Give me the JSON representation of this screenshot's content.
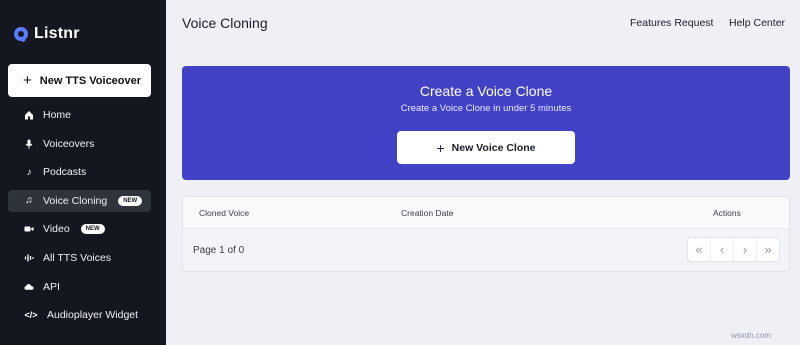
{
  "app": {
    "brand": "Listnr"
  },
  "sidebar": {
    "new_button": "New TTS Voiceover",
    "items": [
      {
        "label": "Home",
        "icon": "home-icon",
        "active": false,
        "badge": ""
      },
      {
        "label": "Voiceovers",
        "icon": "microphone-icon",
        "active": false,
        "badge": ""
      },
      {
        "label": "Podcasts",
        "icon": "music-note-icon",
        "active": false,
        "badge": ""
      },
      {
        "label": "Voice Cloning",
        "icon": "music-notes-icon",
        "active": true,
        "badge": "NEW"
      },
      {
        "label": "Video",
        "icon": "video-camera-icon",
        "active": false,
        "badge": "NEW"
      },
      {
        "label": "All TTS Voices",
        "icon": "waveform-icon",
        "active": false,
        "badge": ""
      },
      {
        "label": "API",
        "icon": "cloud-icon",
        "active": false,
        "badge": ""
      },
      {
        "label": "Audioplayer Widget",
        "icon": "code-icon",
        "active": false,
        "badge": ""
      }
    ]
  },
  "header": {
    "title": "Voice Cloning",
    "links": [
      "Features Request",
      "Help Center"
    ]
  },
  "hero": {
    "title": "Create a Voice Clone",
    "subtitle": "Create a Voice Clone in under 5 minutes",
    "button": "New Voice Clone"
  },
  "table": {
    "columns": [
      "Cloned Voice",
      "Creation Date",
      "Actions"
    ],
    "rows": [],
    "page_info": "Page 1 of 0"
  },
  "watermark": "wsxdn.com",
  "colors": {
    "sidebar_bg": "#14171f",
    "accent": "#4242c6",
    "page_bg": "#eef0f6"
  }
}
